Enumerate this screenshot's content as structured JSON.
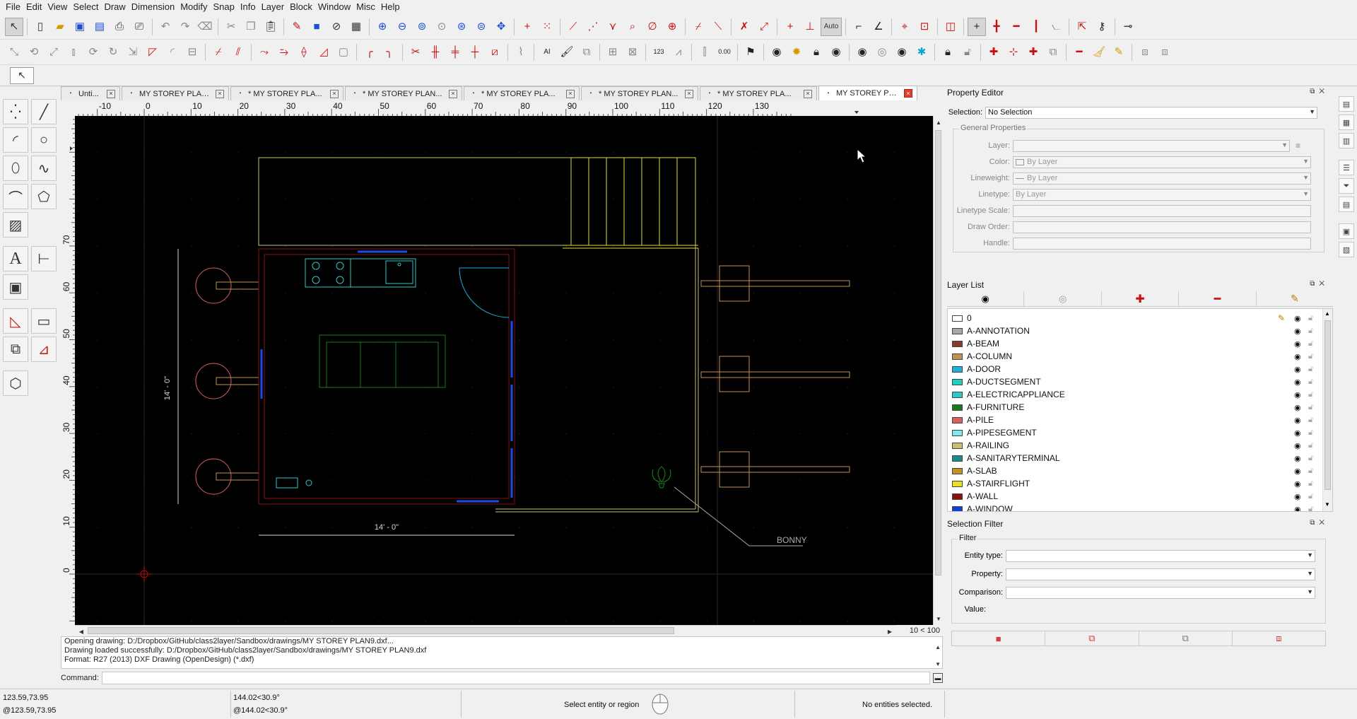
{
  "menu": [
    "File",
    "Edit",
    "View",
    "Select",
    "Draw",
    "Dimension",
    "Modify",
    "Snap",
    "Info",
    "Layer",
    "Block",
    "Window",
    "Misc",
    "Help"
  ],
  "toolbar": {
    "auto_label": "Auto",
    "value_label_123": "123",
    "value_label_000": "0.00",
    "value_label_ai": "AI"
  },
  "tabs": [
    {
      "label": "Unti...",
      "active": false
    },
    {
      "label": "MY STOREY PLAN...",
      "active": false
    },
    {
      "label": "* MY STOREY PLA...",
      "active": false
    },
    {
      "label": "* MY STOREY PLAN...",
      "active": false
    },
    {
      "label": "* MY STOREY PLA...",
      "active": false
    },
    {
      "label": "* MY STOREY PLAN...",
      "active": false
    },
    {
      "label": "* MY STOREY PLA...",
      "active": false
    },
    {
      "label": "MY STOREY PLAN...",
      "active": true
    }
  ],
  "ruler": {
    "horizontal": [
      "-10",
      "0",
      "10",
      "20",
      "30",
      "40",
      "50",
      "60",
      "70",
      "80",
      "90",
      "100",
      "110",
      "120",
      "130"
    ],
    "vertical": [
      "70",
      "60",
      "50",
      "40",
      "30",
      "20",
      "10",
      "0"
    ]
  },
  "drawing": {
    "dim_vertical": "14' - 0\"",
    "dim_horizontal": "14' - 0\"",
    "label_bonny": "BONNY"
  },
  "grid_info": "10 < 100",
  "command": {
    "history": [
      "Opening drawing: D:/Dropbox/GitHub/class2layer/Sandbox/drawings/MY STOREY PLAN9.dxf...",
      "Drawing loaded successfully: D:/Dropbox/GitHub/class2layer/Sandbox/drawings/MY STOREY PLAN9.dxf",
      "Format: R27 (2013) DXF Drawing (OpenDesign) (*.dxf)"
    ],
    "prompt": "Command:"
  },
  "status": {
    "coord_abs": "123.59,73.95",
    "coord_rel": "@123.59,73.95",
    "polar_abs": "144.02<30.9°",
    "polar_rel": "@144.02<30.9°",
    "action": "Select entity or region",
    "selection": "No entities selected."
  },
  "property_editor": {
    "title": "Property Editor",
    "selection_label": "Selection:",
    "selection_value": "No Selection",
    "group_title": "General Properties",
    "rows": [
      {
        "label": "Layer:",
        "value": ""
      },
      {
        "label": "Color:",
        "value": "By Layer"
      },
      {
        "label": "Lineweight:",
        "value": "By Layer"
      },
      {
        "label": "Linetype:",
        "value": "By Layer"
      },
      {
        "label": "Linetype Scale:",
        "value": ""
      },
      {
        "label": "Draw Order:",
        "value": ""
      },
      {
        "label": "Handle:",
        "value": ""
      }
    ]
  },
  "layer_list": {
    "title": "Layer List",
    "layers": [
      {
        "name": "0",
        "color": "#ffffff"
      },
      {
        "name": "A-ANNOTATION",
        "color": "#a8a8a8"
      },
      {
        "name": "A-BEAM",
        "color": "#8a3a2a"
      },
      {
        "name": "A-COLUMN",
        "color": "#c29050"
      },
      {
        "name": "A-DOOR",
        "color": "#1ab0d8"
      },
      {
        "name": "A-DUCTSEGMENT",
        "color": "#20d0c0"
      },
      {
        "name": "A-ELECTRICAPPLIANCE",
        "color": "#30c8c8"
      },
      {
        "name": "A-FURNITURE",
        "color": "#1a7a1a"
      },
      {
        "name": "A-PILE",
        "color": "#d86060"
      },
      {
        "name": "A-PIPESEGMENT",
        "color": "#80e8e8"
      },
      {
        "name": "A-RAILING",
        "color": "#c8c070"
      },
      {
        "name": "A-SANITARYTERMINAL",
        "color": "#1a8a8a"
      },
      {
        "name": "A-SLAB",
        "color": "#c89020"
      },
      {
        "name": "A-STAIRFLIGHT",
        "color": "#e8e020"
      },
      {
        "name": "A-WALL",
        "color": "#8a1010"
      },
      {
        "name": "A-WINDOW",
        "color": "#1040d8"
      }
    ]
  },
  "selection_filter": {
    "title": "Selection Filter",
    "group_title": "Filter",
    "rows": [
      {
        "label": "Entity type:"
      },
      {
        "label": "Property:"
      },
      {
        "label": "Comparison:"
      },
      {
        "label": "Value:"
      }
    ]
  }
}
